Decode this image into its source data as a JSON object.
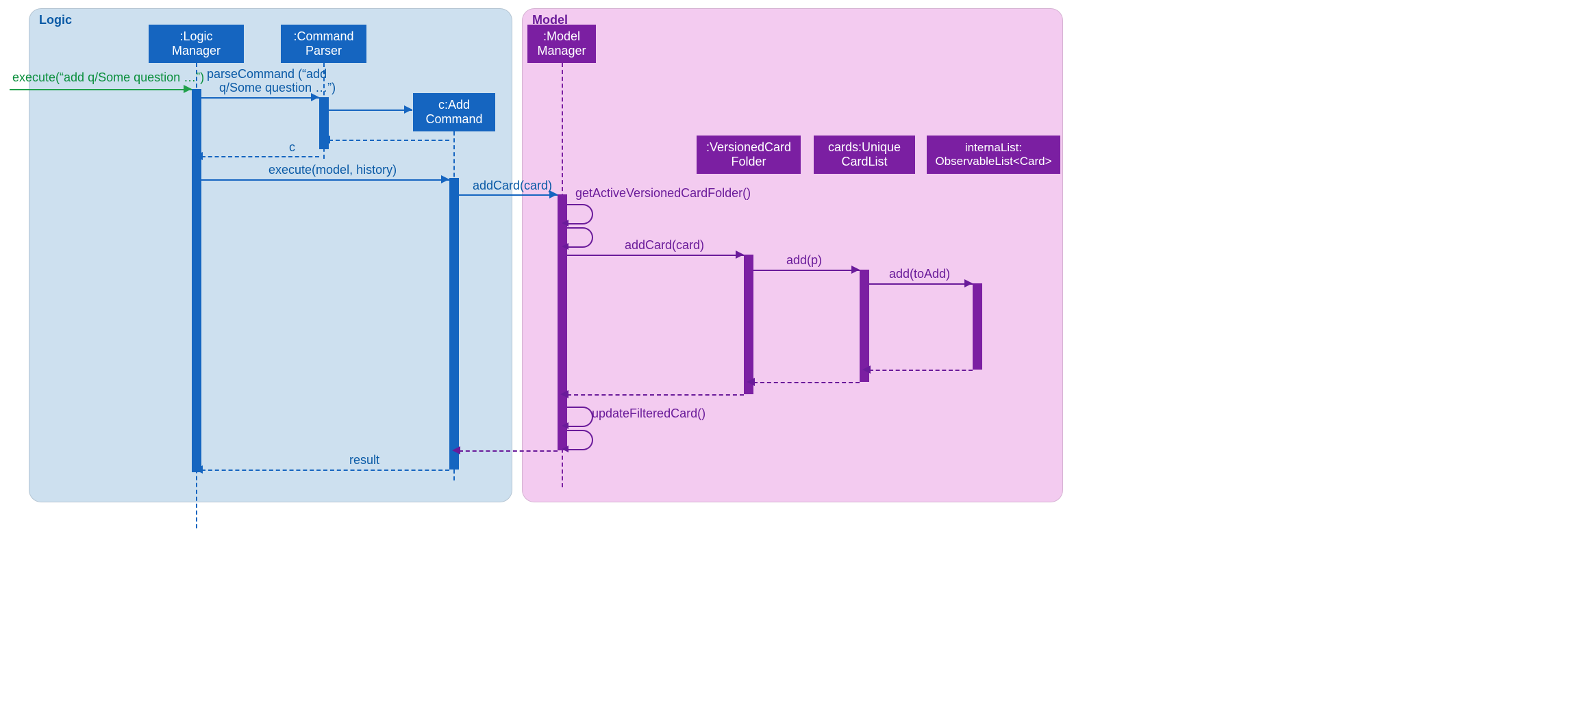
{
  "packages": {
    "logic": {
      "title": "Logic"
    },
    "model": {
      "title": "Model"
    }
  },
  "lifelines": {
    "logicManager": {
      "label": ":Logic\nManager"
    },
    "commandParser": {
      "label": ":Command\nParser"
    },
    "addCommand": {
      "label": "c:Add\nCommand"
    },
    "modelManager": {
      "label": ":Model\nManager"
    },
    "versionedCardFolder": {
      "label": ":VersionedCard\nFolder"
    },
    "uniqueCardList": {
      "label": "cards:Unique\nCardList"
    },
    "observableList": {
      "label": "internaList:\nObservableList<Card>"
    }
  },
  "messages": {
    "execute_in": "execute(“add q/Some question …”)",
    "parseCommand_l1": "parseCommand (“add",
    "parseCommand_l2": "q/Some question …”)",
    "return_c": "c",
    "execute_model": "execute(model, history)",
    "addCard1": "addCard(card)",
    "getActive": "getActiveVersionedCardFolder()",
    "addCard2": "addCard(card)",
    "add_p": "add(p)",
    "add_toAdd": "add(toAdd)",
    "updateFiltered": "updateFilteredCard()",
    "result": "result"
  },
  "colors": {
    "blue": "#1565c0",
    "green": "#20a04a",
    "purple": "#7b1fa2",
    "logicBg": "#cde0ef",
    "modelBg": "#f3cbf0"
  }
}
